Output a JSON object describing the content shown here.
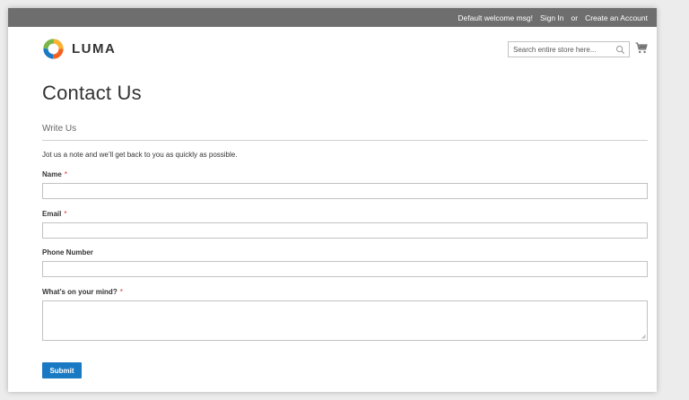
{
  "topbar": {
    "welcome": "Default welcome msg!",
    "sign_in": "Sign In",
    "or": "or",
    "create_account": "Create an Account",
    "background_color": "#6e6e6e"
  },
  "header": {
    "logo_text": "LUMA",
    "search": {
      "placeholder": "Search entire store here..."
    },
    "icons": {
      "search": "search-icon",
      "cart": "cart-icon",
      "logo": "luma-logo-icon"
    }
  },
  "page": {
    "title": "Contact Us",
    "legend": "Write Us",
    "note": "Jot us a note and we’ll get back to you as quickly as possible."
  },
  "form": {
    "fields": [
      {
        "label": "Name",
        "required": "*",
        "value": ""
      },
      {
        "label": "Email",
        "required": "*",
        "value": ""
      },
      {
        "label": "Phone Number",
        "required": "",
        "value": ""
      },
      {
        "label": "What’s on your mind?",
        "required": "*",
        "value": ""
      }
    ],
    "submit_label": "Submit"
  },
  "colors": {
    "primary_button": "#1979c3",
    "required_marker": "#e02b27",
    "logo_orange": "#f26322",
    "logo_blue": "#1979c3",
    "logo_green": "#7ab648",
    "logo_yellow": "#f9b233"
  }
}
